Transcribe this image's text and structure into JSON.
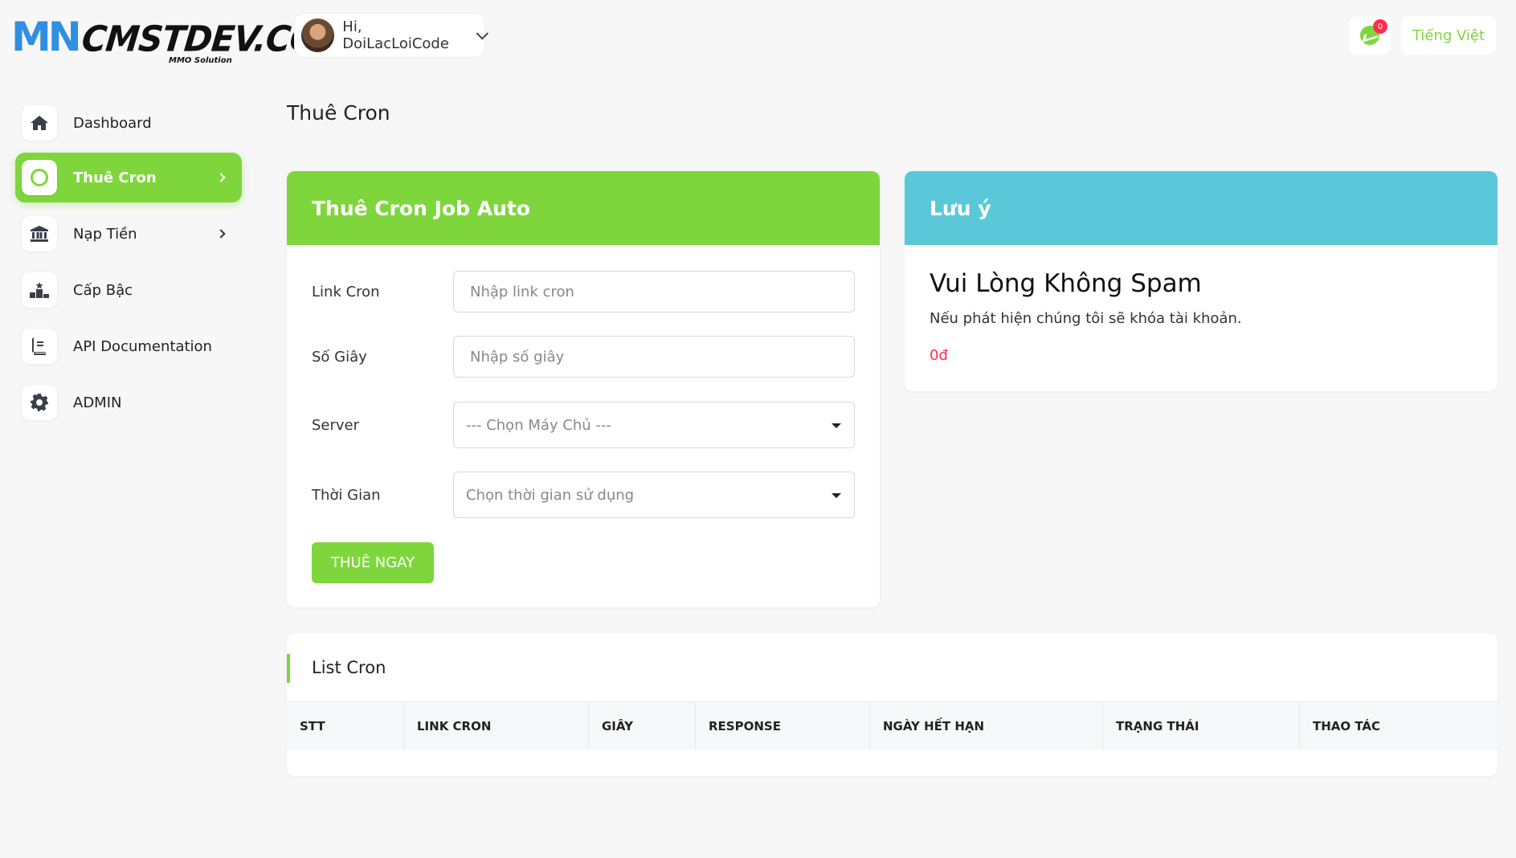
{
  "brand": {
    "logo_mark": "MN",
    "logo_word": "CMSTDEV.CO",
    "logo_sub": "MMO Solution"
  },
  "topbar": {
    "greeting": "Hi, DoiLacLoiCode",
    "notification_count": "0",
    "language": "Tiếng Việt"
  },
  "sidebar": {
    "items": [
      {
        "label": "Dashboard",
        "icon": "home-icon"
      },
      {
        "label": "Thuê Cron",
        "icon": "cron-ring-icon",
        "active": true
      },
      {
        "label": "Nạp Tiền",
        "icon": "bank-icon"
      },
      {
        "label": "Cấp Bậc",
        "icon": "rank-icon"
      },
      {
        "label": "API Documentation",
        "icon": "book-icon"
      },
      {
        "label": "ADMIN",
        "icon": "gear-icon"
      }
    ]
  },
  "page": {
    "title": "Thuê Cron"
  },
  "form": {
    "title": "Thuê Cron Job Auto",
    "link_label": "Link Cron",
    "link_placeholder": "Nhập link cron",
    "seconds_label": "Số Giây",
    "seconds_placeholder": "Nhập số giây",
    "server_label": "Server",
    "server_selected": "--- Chọn Máy Chủ ---",
    "time_label": "Thời Gian",
    "time_selected": "Chọn thời gian sử dụng",
    "submit_label": "THUÊ NGAY"
  },
  "note": {
    "title": "Lưu ý",
    "heading": "Vui Lòng Không Spam",
    "text": "Nếu phát hiện chúng tôi sẽ khóa tài khoản.",
    "balance": "0đ"
  },
  "list": {
    "title": "List Cron",
    "columns": [
      "STT",
      "LINK CRON",
      "GIÂY",
      "RESPONSE",
      "NGÀY HẾT HẠN",
      "TRẠNG THÁI",
      "THAO TÁC"
    ]
  },
  "colors": {
    "accent": "#7ed63c",
    "info": "#5bc8d9",
    "danger": "#ff2e4d",
    "background": "#f7f7f8"
  }
}
